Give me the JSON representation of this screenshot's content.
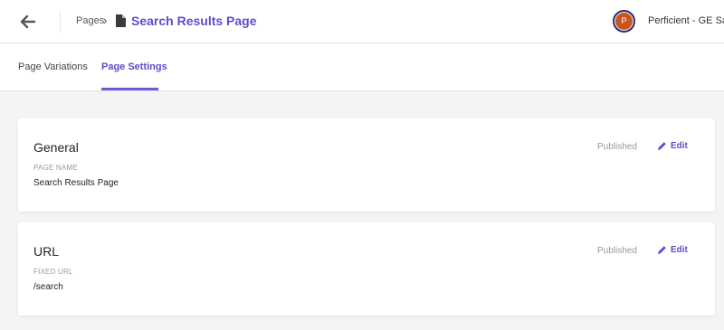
{
  "header": {
    "breadcrumb_root": "Pages",
    "breadcrumb_separator": "›",
    "page_title": "Search Results Page",
    "avatar_initial": "P",
    "account_name": "Perficient - GE San"
  },
  "tabs": [
    {
      "label": "Page Variations",
      "active": false
    },
    {
      "label": "Page Settings",
      "active": true
    }
  ],
  "cards": [
    {
      "title": "General",
      "field_label": "PAGE NAME",
      "field_value": "Search Results Page",
      "status": "Published",
      "edit_label": "Edit"
    },
    {
      "title": "URL",
      "field_label": "FIXED URL",
      "field_value": "/search",
      "status": "Published",
      "edit_label": "Edit"
    }
  ],
  "colors": {
    "accent": "#5b4fc9",
    "avatar_bg": "#c8551c"
  },
  "icons": [
    "back-arrow-icon",
    "document-icon",
    "pencil-icon"
  ]
}
